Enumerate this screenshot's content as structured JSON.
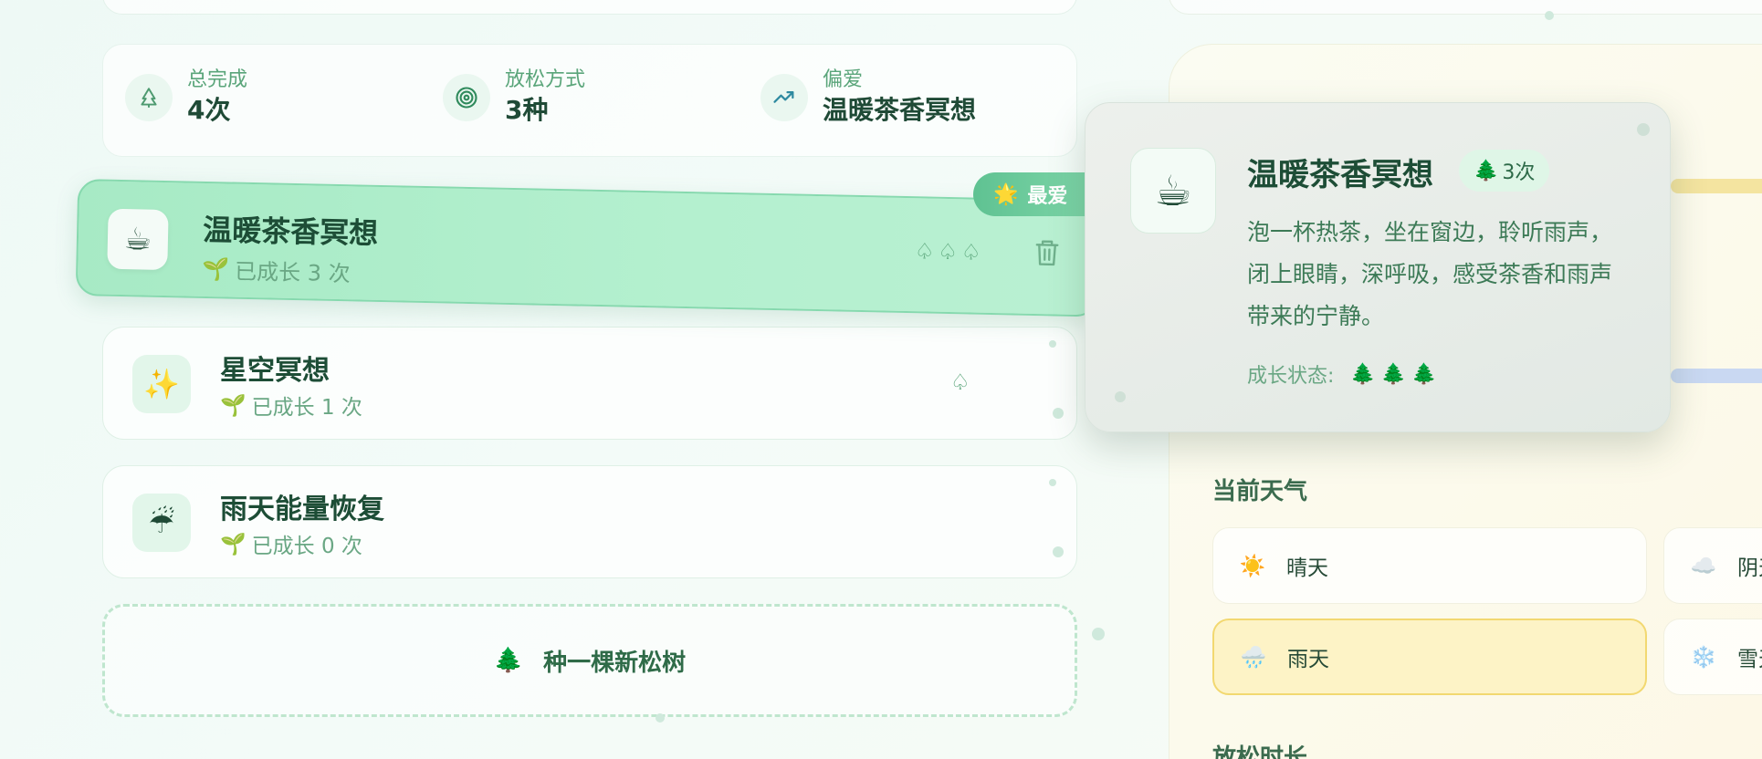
{
  "stats": [
    {
      "label": "总完成",
      "value": "4次",
      "icon": "tree-outline-icon"
    },
    {
      "label": "放松方式",
      "value": "3种",
      "icon": "target-icon"
    },
    {
      "label": "偏爱",
      "value": "温暖茶香冥想",
      "icon": "trend-up-icon"
    }
  ],
  "cards": [
    {
      "emoji": "☕",
      "title": "温暖茶香冥想",
      "sub": "已成长 3 次",
      "trees": "♤♤♤",
      "favorite": true
    },
    {
      "emoji": "✨",
      "title": "星空冥想",
      "sub": "已成长 1 次",
      "trees": "♤"
    },
    {
      "emoji": "☔",
      "title": "雨天能量恢复",
      "sub": "已成长 0 次",
      "trees": ""
    }
  ],
  "favorite_badge": {
    "star": "🌟",
    "label": "最爱"
  },
  "sprout": "🌱",
  "plant_button": {
    "icon": "🌲",
    "label": "种一棵新松树"
  },
  "popover": {
    "emoji": "☕",
    "title": "温暖茶香冥想",
    "count_icon": "🌲",
    "count": "3次",
    "description": "泡一杯热茶，坐在窗边，聆听雨声，闭上眼睛，深呼吸，感受茶香和雨声带来的宁静。",
    "state_label": "成长状态:",
    "state_trees": "🌲🌲🌲"
  },
  "weather_section": {
    "label": "当前天气"
  },
  "weather": [
    {
      "icon": "☀️",
      "label": "晴天",
      "active": false
    },
    {
      "icon": "☁️",
      "label": "阴天",
      "active": false
    },
    {
      "icon": "🌧️",
      "label": "雨天",
      "active": true
    },
    {
      "icon": "❄️",
      "label": "雪天",
      "active": false
    }
  ],
  "duration_section": {
    "label": "放松时长"
  }
}
